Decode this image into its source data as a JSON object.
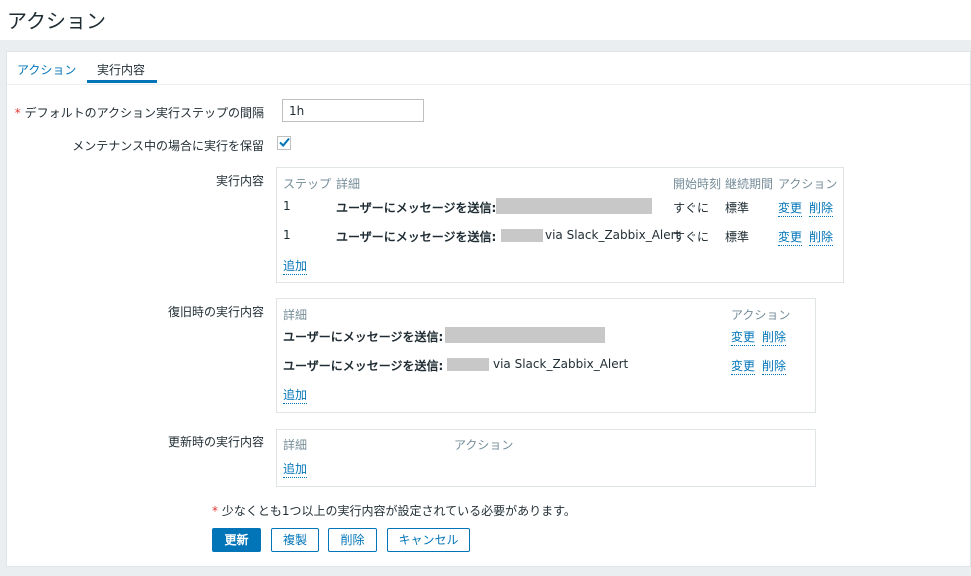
{
  "header": {
    "title": "アクション"
  },
  "tabs": [
    {
      "label": "アクション"
    },
    {
      "label": "実行内容"
    }
  ],
  "form": {
    "default_step_label": "デフォルトのアクション実行ステップの間隔",
    "default_step_value": "1h",
    "pause_label": "メンテナンス中の場合に実行を保留",
    "pause_checked": true,
    "operations_label": "実行内容",
    "recovery_label": "復旧時の実行内容",
    "update_label": "更新時の実行内容"
  },
  "operations": {
    "headers": {
      "step": "ステップ",
      "details": "詳細",
      "start": "開始時刻",
      "duration": "継続期間",
      "action": "アクション"
    },
    "rows": [
      {
        "step": "1",
        "details": "ユーザーにメッセージを送信:",
        "via": "",
        "start": "すぐに",
        "duration": "標準",
        "edit": "変更",
        "remove": "削除"
      },
      {
        "step": "1",
        "details": "ユーザーにメッセージを送信:",
        "via": "via Slack_Zabbix_Alert",
        "start": "すぐに",
        "duration": "標準",
        "edit": "変更",
        "remove": "削除"
      }
    ],
    "add": "追加"
  },
  "recovery": {
    "headers": {
      "details": "詳細",
      "action": "アクション"
    },
    "rows": [
      {
        "details": "ユーザーにメッセージを送信:",
        "via": "",
        "edit": "変更",
        "remove": "削除"
      },
      {
        "details": "ユーザーにメッセージを送信:",
        "via": "via Slack_Zabbix_Alert",
        "edit": "変更",
        "remove": "削除"
      }
    ],
    "add": "追加"
  },
  "update_ops": {
    "headers": {
      "details": "詳細",
      "action": "アクション"
    },
    "add": "追加"
  },
  "note": "少なくとも1つ以上の実行内容が設定されている必要があります。",
  "buttons": {
    "update": "更新",
    "clone": "複製",
    "delete": "削除",
    "cancel": "キャンセル"
  },
  "colors": {
    "accent": "#0275b8",
    "required": "#e33734",
    "header_text": "#768d99"
  }
}
